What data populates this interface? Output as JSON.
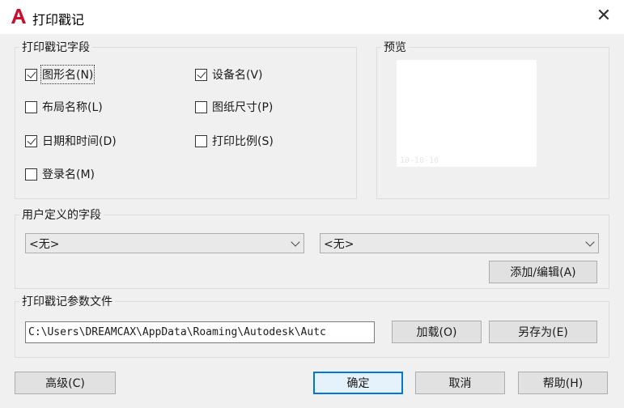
{
  "window": {
    "title": "打印戳记",
    "close_glyph": "✕"
  },
  "fields_group": {
    "label": "打印戳记字段",
    "checkboxes": [
      {
        "label": "图形名(N)",
        "checked": true
      },
      {
        "label": "设备名(V)",
        "checked": true
      },
      {
        "label": "布局名称(L)",
        "checked": false
      },
      {
        "label": "图纸尺寸(P)",
        "checked": false
      },
      {
        "label": "日期和时间(D)",
        "checked": true
      },
      {
        "label": "打印比例(S)",
        "checked": false
      },
      {
        "label": "登录名(M)",
        "checked": false
      }
    ]
  },
  "preview_group": {
    "label": "预览",
    "stamp_text": "10-10-10"
  },
  "user_fields_group": {
    "label": "用户定义的字段",
    "select_left": "<无>",
    "select_right": "<无>",
    "add_edit_button": "添加/编辑(A)"
  },
  "param_file_group": {
    "label": "打印戳记参数文件",
    "path_value": "C:\\Users\\DREAMCAX\\AppData\\Roaming\\Autodesk\\Autc",
    "load_button": "加载(O)",
    "save_as_button": "另存为(E)"
  },
  "footer": {
    "advanced_button": "高级(C)",
    "ok_button": "确定",
    "cancel_button": "取消",
    "help_button": "帮助(H)"
  },
  "colors": {
    "accent": "#0078d7",
    "app_icon": "#c8102e"
  },
  "icons": {
    "app": "autocad-logo-icon",
    "close": "close-icon",
    "dropdown": "chevron-down-icon"
  }
}
